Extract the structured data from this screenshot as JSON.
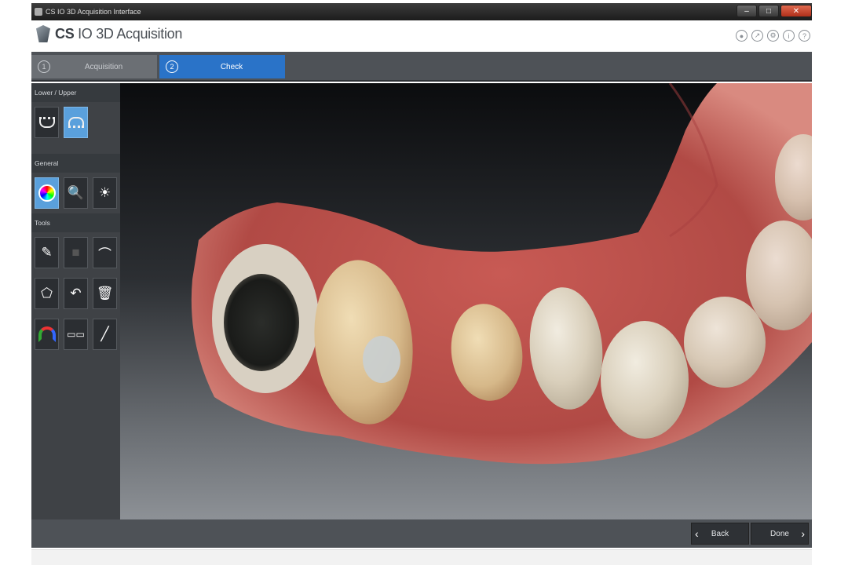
{
  "window": {
    "title": "CS IO 3D Acquisition Interface",
    "controls": [
      "minimize",
      "maximize",
      "close"
    ]
  },
  "header": {
    "logo_prefix": "CS",
    "logo_title": "IO 3D Acquisition",
    "icons": [
      "pin-icon",
      "export-icon",
      "settings-icon",
      "info-icon",
      "help-icon"
    ]
  },
  "steps": [
    {
      "number": "1",
      "label": "Acquisition",
      "state": "inactive"
    },
    {
      "number": "2",
      "label": "Check",
      "state": "active"
    }
  ],
  "panel": {
    "lower_upper": {
      "title": "Lower / Upper"
    },
    "general": {
      "title": "General"
    },
    "tools": {
      "title": "Tools"
    }
  },
  "footer": {
    "back_label": "Back",
    "done_label": "Done"
  },
  "colors": {
    "accent": "#2a73c8",
    "active_tool": "#5aa0dc",
    "panel_bg": "#3f4246"
  }
}
